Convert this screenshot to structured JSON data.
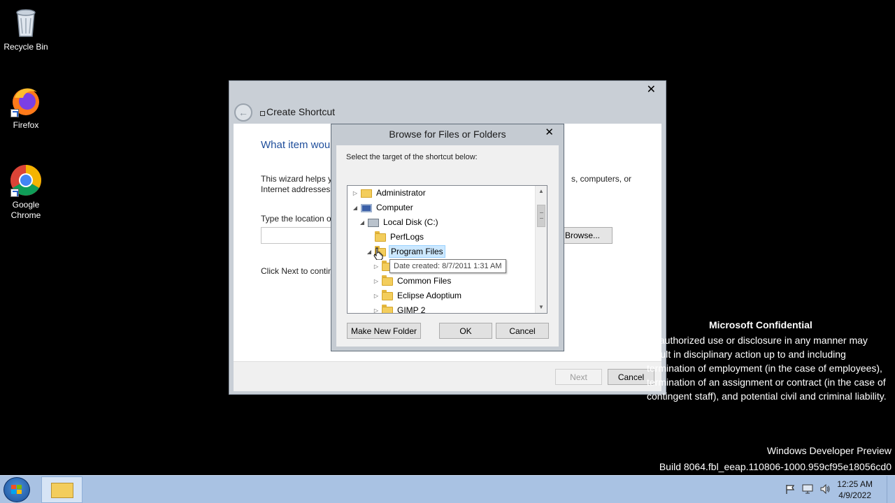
{
  "desktop": {
    "icons": [
      {
        "label": "Recycle Bin",
        "icon": "recycle-bin-icon"
      },
      {
        "label": "Firefox",
        "icon": "firefox-icon"
      },
      {
        "label": "Google Chrome",
        "icon": "chrome-icon"
      }
    ]
  },
  "wizard": {
    "close_glyph": "✕",
    "back_glyph": "←",
    "title": "Create Shortcut",
    "heading": "What item wou",
    "text": "This wizard helps yo",
    "text2": "s, computers, or",
    "text3": "Internet addresses.",
    "location_label": "Type the location o",
    "location_value": "",
    "browse_label": "Browse...",
    "next_hint": "Click Next to contin",
    "next_label": "Next",
    "cancel_label": "Cancel"
  },
  "browse_dialog": {
    "title": "Browse for Files or Folders",
    "close_glyph": "✕",
    "prompt": "Select the target of the shortcut below:",
    "tree": [
      {
        "label": "Administrator",
        "icon": "user-folder-icon",
        "expander": "▷"
      },
      {
        "label": "Computer",
        "icon": "computer-icon",
        "expander": "◢"
      },
      {
        "label": "Local Disk (C:)",
        "icon": "drive-icon",
        "expander": "◢"
      },
      {
        "label": "PerfLogs",
        "icon": "folder-icon",
        "expander": ""
      },
      {
        "label": "Program Files",
        "icon": "folder-icon",
        "expander": "◢",
        "selected": true
      },
      {
        "label": "",
        "icon": "folder-icon",
        "expander": "▷"
      },
      {
        "label": "Common Files",
        "icon": "folder-icon",
        "expander": "▷"
      },
      {
        "label": "Eclipse Adoptium",
        "icon": "folder-icon",
        "expander": "▷"
      },
      {
        "label": "GIMP 2",
        "icon": "folder-icon",
        "expander": "▷"
      }
    ],
    "tooltip": "Date created: 8/7/2011 1:31 AM",
    "scroll_up": "▲",
    "scroll_down": "▼",
    "make_new_folder_label": "Make New Folder",
    "ok_label": "OK",
    "cancel_label": "Cancel"
  },
  "confidential": {
    "title": "Microsoft Confidential",
    "body": "Unauthorized use or disclosure in any manner may result in disciplinary action up to and including termination of employment (in the case of employees), termination of an assignment or contract (in the case of contingent staff), and potential civil and criminal liability."
  },
  "build": {
    "line1": "Windows Developer Preview",
    "line2": "Build 8064.fbl_eeap.110806-1000.959cf95e18056cd0"
  },
  "taskbar": {
    "tray_icons": [
      "flag-icon",
      "network-icon",
      "volume-icon"
    ],
    "time": "12:25 AM",
    "date": "4/9/2022"
  }
}
